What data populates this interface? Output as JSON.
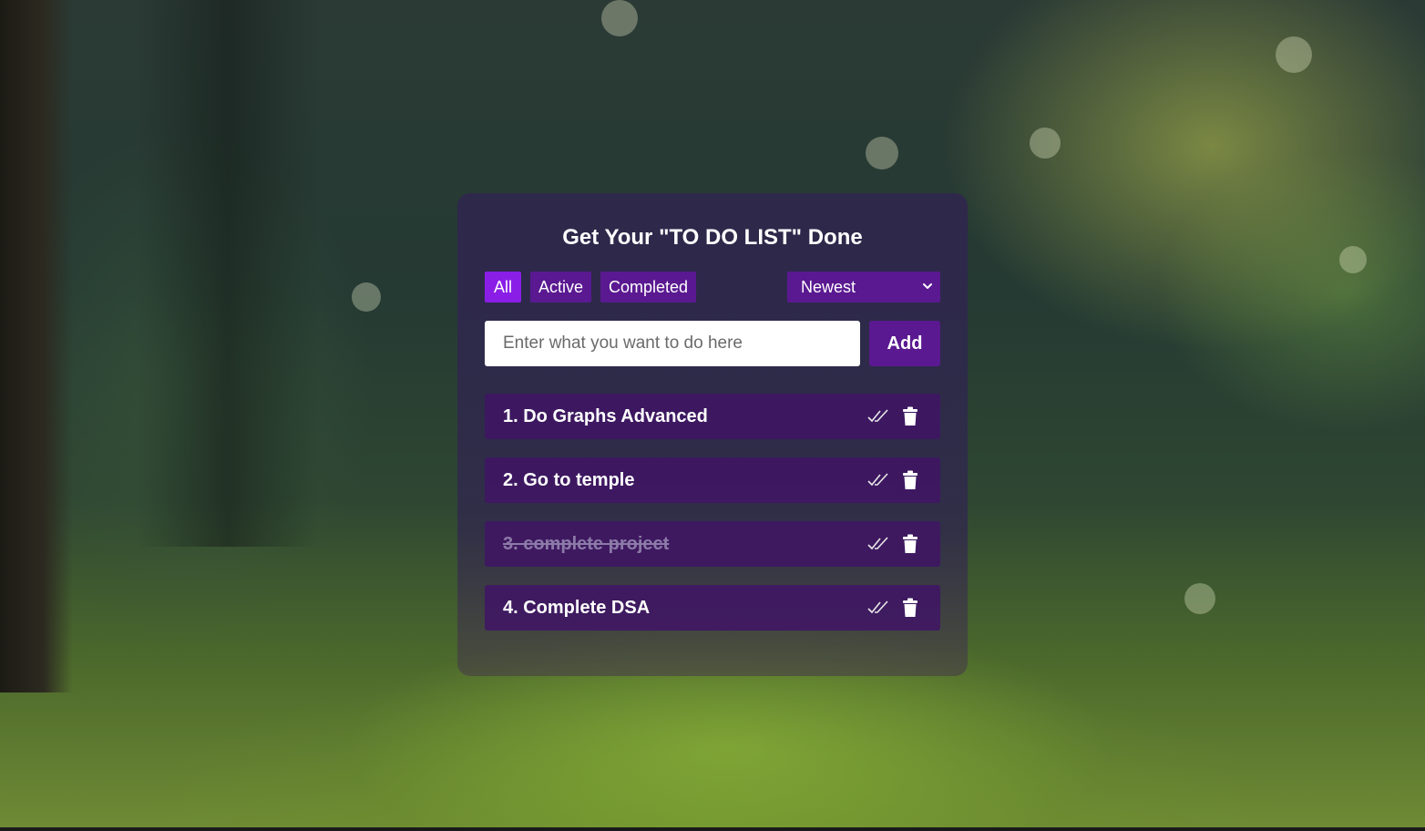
{
  "title": "Get Your \"TO DO LIST\" Done",
  "filters": [
    {
      "label": "All",
      "active": true
    },
    {
      "label": "Active",
      "active": false
    },
    {
      "label": "Completed",
      "active": false
    }
  ],
  "sort": {
    "selected": "Newest",
    "icon": "chevron-down-icon"
  },
  "input": {
    "placeholder": "Enter what you want to do here",
    "value": ""
  },
  "add_label": "Add",
  "tasks": [
    {
      "text": "1. Do Graphs Advanced",
      "completed": false
    },
    {
      "text": "2. Go to temple",
      "completed": false
    },
    {
      "text": "3. complete project",
      "completed": true
    },
    {
      "text": "4. Complete DSA",
      "completed": false
    }
  ],
  "icons": {
    "complete": "double-check-icon",
    "delete": "trash-icon"
  },
  "colors": {
    "accent": "#5a1991",
    "accent_active": "#8a1ee6",
    "text": "#ffffff"
  }
}
